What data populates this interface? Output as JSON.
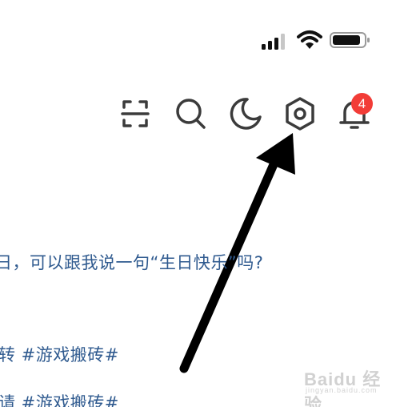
{
  "status_bar": {
    "signal_icon": "cellular-signal-icon",
    "wifi_icon": "wifi-icon",
    "battery_icon": "battery-icon"
  },
  "toolbar": {
    "icons": [
      "scan-icon",
      "search-icon",
      "night-mode-icon",
      "settings-icon",
      "notification-bell-icon"
    ],
    "notification_badge": "4",
    "badge_color": "#f23c37"
  },
  "feed": {
    "line1": "日，可以跟我说一句“生日快乐”吗?",
    "line2": "转 #游戏搬砖#",
    "line3": "请 #游戏搬砖#"
  },
  "watermark": {
    "text": "Baidu 经验",
    "sub": "jingyan.baidu.com"
  },
  "colors": {
    "icon_stroke": "#3b3b3b",
    "link_text": "#2f5a8f",
    "arrow": "#000000"
  }
}
